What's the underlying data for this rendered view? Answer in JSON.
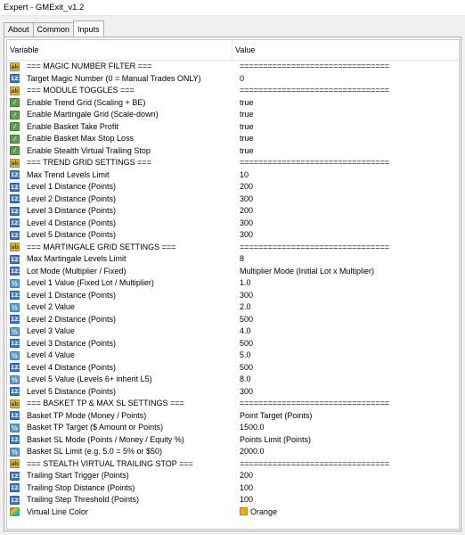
{
  "window": {
    "title": "Expert - GMExit_v1.2"
  },
  "tabs": [
    "About",
    "Common",
    "Inputs"
  ],
  "grid": {
    "col_variable": "Variable",
    "col_value": "Value"
  },
  "rows": [
    {
      "icon": "ab",
      "name": "=== MAGIC NUMBER FILTER ===",
      "value": "================================"
    },
    {
      "icon": "123",
      "name": "Target Magic Number (0 = Manual Trades ONLY)",
      "value": "0"
    },
    {
      "icon": "ab",
      "name": "=== MODULE TOGGLES ===",
      "value": "================================"
    },
    {
      "icon": "bool",
      "name": "Enable Trend Grid (Scaling + BE)",
      "value": "true"
    },
    {
      "icon": "bool",
      "name": "Enable Martingale Grid (Scale-down)",
      "value": "true"
    },
    {
      "icon": "bool",
      "name": "Enable Basket Take Profit",
      "value": "true"
    },
    {
      "icon": "bool",
      "name": "Enable Basket Max Stop Loss",
      "value": "true"
    },
    {
      "icon": "bool",
      "name": "Enable Stealth Virtual Trailing Stop",
      "value": "true"
    },
    {
      "icon": "ab",
      "name": "=== TREND GRID SETTINGS ===",
      "value": "================================"
    },
    {
      "icon": "123",
      "name": "Max Trend Levels Limit",
      "value": "10"
    },
    {
      "icon": "123",
      "name": "Level 1 Distance (Points)",
      "value": "200"
    },
    {
      "icon": "123",
      "name": "Level 2 Distance (Points)",
      "value": "300"
    },
    {
      "icon": "123",
      "name": "Level 3 Distance (Points)",
      "value": "200"
    },
    {
      "icon": "123",
      "name": "Level 4 Distance (Points)",
      "value": "300"
    },
    {
      "icon": "123",
      "name": "Level 5 Distance (Points)",
      "value": "300"
    },
    {
      "icon": "ab",
      "name": "=== MARTINGALE GRID SETTINGS ===",
      "value": "================================"
    },
    {
      "icon": "123",
      "name": "Max Martingale Levels Limit",
      "value": "8"
    },
    {
      "icon": "123",
      "name": "Lot Mode (Multiplier / Fixed)",
      "value": "Multiplier Mode (Initial Lot x Multiplier)"
    },
    {
      "icon": "v",
      "name": "Level 1 Value (Fixed Lot / Multiplier)",
      "value": "1.0"
    },
    {
      "icon": "123",
      "name": "Level 1 Distance (Points)",
      "value": "300"
    },
    {
      "icon": "v",
      "name": "Level 2 Value",
      "value": "2.0"
    },
    {
      "icon": "123",
      "name": "Level 2 Distance (Points)",
      "value": "500"
    },
    {
      "icon": "v",
      "name": "Level 3 Value",
      "value": "4.0"
    },
    {
      "icon": "123",
      "name": "Level 3 Distance (Points)",
      "value": "500"
    },
    {
      "icon": "v",
      "name": "Level 4 Value",
      "value": "5.0"
    },
    {
      "icon": "123",
      "name": "Level 4 Distance (Points)",
      "value": "500"
    },
    {
      "icon": "v",
      "name": "Level 5 Value (Levels 6+ inherit L5)",
      "value": "8.0"
    },
    {
      "icon": "123",
      "name": "Level 5 Distance (Points)",
      "value": "300"
    },
    {
      "icon": "ab",
      "name": "=== BASKET TP & MAX SL SETTINGS ===",
      "value": "================================"
    },
    {
      "icon": "123",
      "name": "Basket TP Mode (Money / Points)",
      "value": "Point Target (Points)"
    },
    {
      "icon": "v",
      "name": "Basket TP Target ($ Amount or Points)",
      "value": "1500.0"
    },
    {
      "icon": "123",
      "name": "Basket SL Mode (Points / Money / Equity %)",
      "value": "Points Limit (Points)"
    },
    {
      "icon": "v",
      "name": "Basket SL Limit (e.g. 5.0 = 5% or $50)",
      "value": "2000.0"
    },
    {
      "icon": "ab",
      "name": "=== STEALTH VIRTUAL TRAILING STOP ===",
      "value": "================================"
    },
    {
      "icon": "123",
      "name": "Trailing Start Trigger (Points)",
      "value": "200"
    },
    {
      "icon": "123",
      "name": "Trailing Stop Distance (Points)",
      "value": "100"
    },
    {
      "icon": "123",
      "name": "Trailing Step Threshold (Points)",
      "value": "100"
    },
    {
      "icon": "color",
      "name": "Virtual Line Color",
      "value": "Orange",
      "swatch": "#ffa500"
    }
  ]
}
